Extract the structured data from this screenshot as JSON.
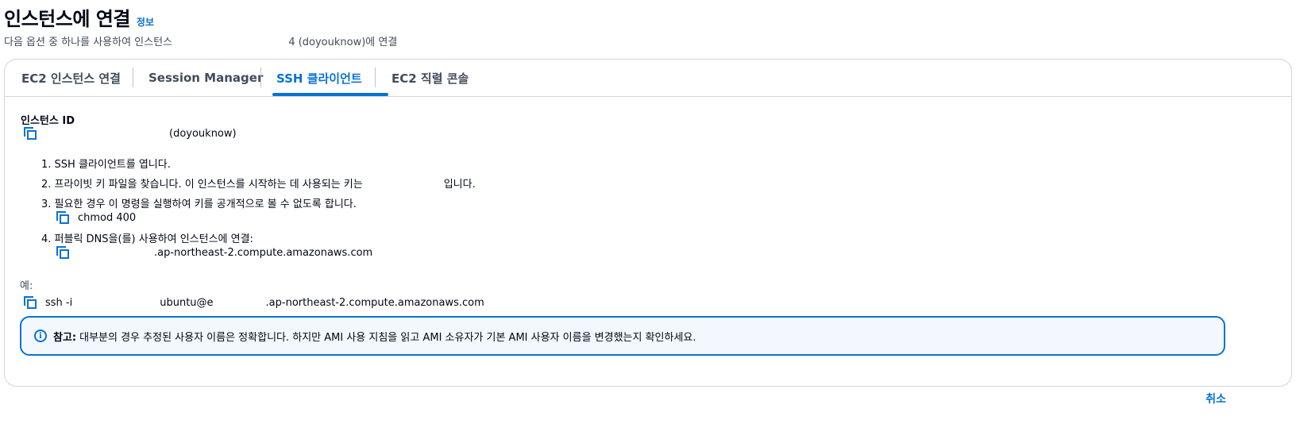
{
  "header": {
    "title": "인스턴스에 연결",
    "info_link": "정보",
    "subtitle_prefix": "다음 옵션 중 하나를 사용하여 인스턴스",
    "subtitle_suffix": "4 (doyouknow)에 연결"
  },
  "tabs": [
    {
      "label": "EC2 인스턴스 연결",
      "active": false
    },
    {
      "label": "Session Manager",
      "active": false
    },
    {
      "label": "SSH 클라이언트",
      "active": true
    },
    {
      "label": "EC2 직렬 콘솔",
      "active": false
    }
  ],
  "instance": {
    "label": "인스턴스 ID",
    "name": "(doyouknow)"
  },
  "steps": {
    "s1": "1. SSH 클라이언트를 엽니다.",
    "s2_prefix": "2. 프라이빗 키 파일을 찾습니다. 이 인스턴스를 시작하는 데 사용되는 키는",
    "s2_suffix": "입니다.",
    "s3": "3. 필요한 경우 이 명령을 실행하여 키를 공개적으로 볼 수 없도록 합니다.",
    "s3_cmd": "chmod 400",
    "s4": "4. 퍼블릭 DNS을(를) 사용하여 인스턴스에 연결:",
    "s4_dns_suffix": ".ap-northeast-2.compute.amazonaws.com"
  },
  "example": {
    "label": "예:",
    "cmd_prefix": "ssh -i",
    "cmd_user": "ubuntu@e",
    "cmd_suffix": ".ap-northeast-2.compute.amazonaws.com"
  },
  "note": {
    "label": "참고:",
    "text": "대부분의 경우 추정된 사용자 이름은 정확합니다. 하지만 AMI 사용 지침을 읽고 AMI 소유자가 기본 AMI 사용자 이름을 변경했는지 확인하세요."
  },
  "footer": {
    "cancel": "취소"
  },
  "colors": {
    "accent": "#0972d3",
    "note_bg": "#f2f8fd",
    "text": "#000716"
  }
}
